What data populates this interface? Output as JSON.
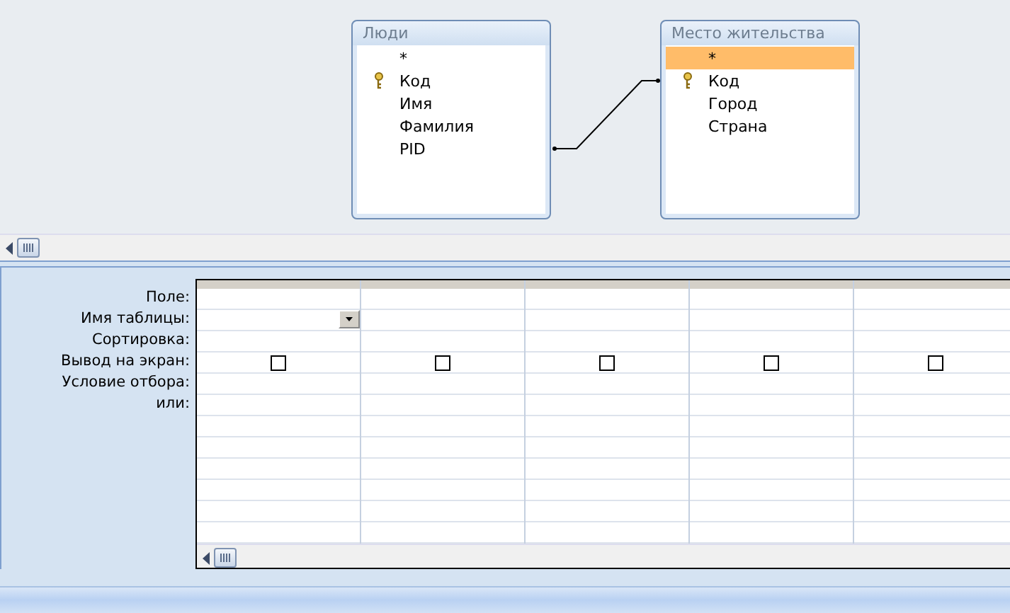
{
  "tables": [
    {
      "title": "Люди",
      "fields": [
        {
          "name": "*",
          "key": false,
          "selected": false
        },
        {
          "name": "Код",
          "key": true,
          "selected": false
        },
        {
          "name": "Имя",
          "key": false,
          "selected": false
        },
        {
          "name": "Фамилия",
          "key": false,
          "selected": false
        },
        {
          "name": "PID",
          "key": false,
          "selected": false
        }
      ]
    },
    {
      "title": "Место жительства",
      "fields": [
        {
          "name": "*",
          "key": false,
          "selected": true
        },
        {
          "name": "Код",
          "key": true,
          "selected": false
        },
        {
          "name": "Город",
          "key": false,
          "selected": false
        },
        {
          "name": "Страна",
          "key": false,
          "selected": false
        }
      ]
    }
  ],
  "grid": {
    "row_labels": [
      "Поле:",
      "Имя таблицы:",
      "Сортировка:",
      "Вывод на экран:",
      "Условие отбора:",
      "или:"
    ],
    "columns": [
      {
        "show": false,
        "focused": true
      },
      {
        "show": false,
        "focused": false
      },
      {
        "show": false,
        "focused": false
      },
      {
        "show": false,
        "focused": false
      },
      {
        "show": false,
        "focused": false
      }
    ]
  }
}
